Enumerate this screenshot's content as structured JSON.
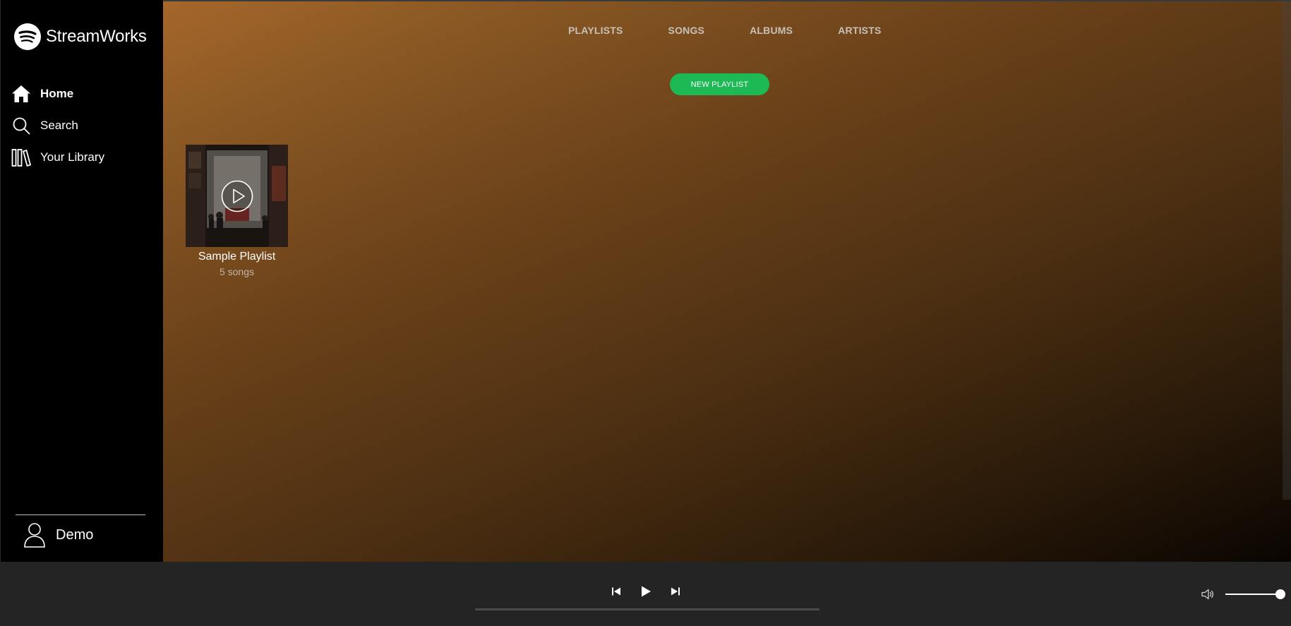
{
  "brand": {
    "name": "StreamWorks"
  },
  "sidebar": {
    "items": [
      {
        "label": "Home",
        "icon": "home-icon",
        "active": true
      },
      {
        "label": "Search",
        "icon": "search-icon",
        "active": false
      },
      {
        "label": "Your Library",
        "icon": "library-icon",
        "active": false
      }
    ]
  },
  "user": {
    "name": "Demo",
    "icon": "user-icon"
  },
  "tabs": [
    "PLAYLISTS",
    "SONGS",
    "ALBUMS",
    "ARTISTS"
  ],
  "actions": {
    "new_playlist": "NEW PLAYLIST"
  },
  "playlists": [
    {
      "title": "Sample Playlist",
      "subtitle": "5 songs"
    }
  ],
  "player": {
    "progress": 0,
    "volume": 1.0
  },
  "colors": {
    "accent": "#1db954",
    "sidebar": "#000000",
    "player_bar": "#242424",
    "gradient_top": "#a5672a"
  }
}
